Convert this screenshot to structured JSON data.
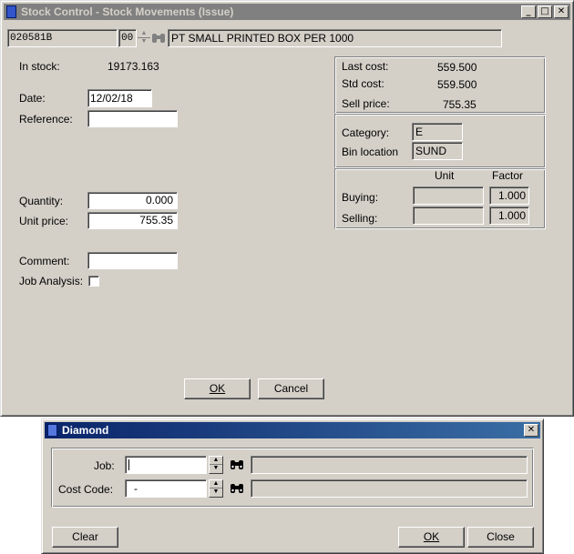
{
  "main_window": {
    "title": "Stock Control - Stock Movements (Issue)",
    "caption_buttons": {
      "minimize": "_",
      "maximize": "□",
      "close": "✕"
    },
    "header": {
      "stock_code": "020581B",
      "suffix": "00",
      "description": "PT SMALL PRINTED BOX PER 1000"
    },
    "in_stock": {
      "label": "In stock:",
      "value": "19173.163"
    },
    "date": {
      "label": "Date:",
      "value": "12/02/18"
    },
    "reference": {
      "label": "Reference:",
      "value": ""
    },
    "quantity": {
      "label": "Quantity:",
      "value": "0.000"
    },
    "unit_price": {
      "label": "Unit price:",
      "value": "755.35"
    },
    "comment": {
      "label": "Comment:",
      "value": ""
    },
    "job_analysis": {
      "label": "Job Analysis:",
      "checked": false
    },
    "cost_panel": {
      "last_cost": {
        "label": "Last cost:",
        "value": "559.500"
      },
      "std_cost": {
        "label": "Std cost:",
        "value": "559.500"
      },
      "sell_price": {
        "label": "Sell price:",
        "value": "755.35"
      }
    },
    "category_panel": {
      "category": {
        "label": "Category:",
        "value": "E"
      },
      "bin_location": {
        "label": "Bin location",
        "value": "SUND"
      }
    },
    "units_panel": {
      "unit_header": "Unit",
      "factor_header": "Factor",
      "buying": {
        "label": "Buying:",
        "unit": "",
        "factor": "1.000"
      },
      "selling": {
        "label": "Selling:",
        "unit": "",
        "factor": "1.000"
      }
    },
    "buttons": {
      "ok": "OK",
      "cancel": "Cancel"
    }
  },
  "dialog": {
    "title": "Diamond",
    "close": "✕",
    "job": {
      "label": "Job:",
      "value": "",
      "description": ""
    },
    "cost_code": {
      "label": "Cost Code:",
      "value": "-",
      "description": ""
    },
    "buttons": {
      "clear": "Clear",
      "ok": "OK",
      "close": "Close"
    }
  },
  "icons": {
    "binoculars": "binoculars-icon",
    "spin_up": "▲",
    "spin_down": "▼"
  }
}
